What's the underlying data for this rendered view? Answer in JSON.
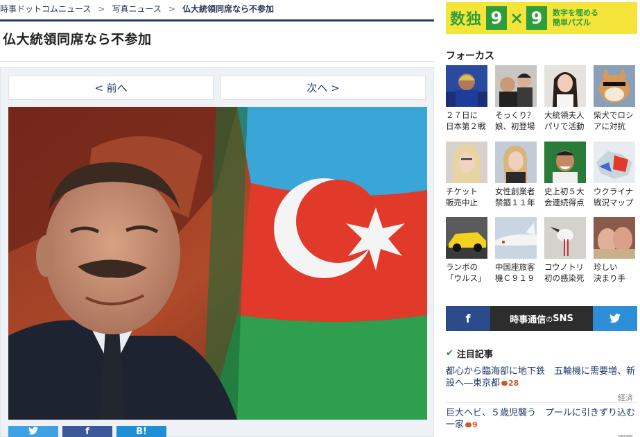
{
  "breadcrumb": {
    "items": [
      "時事ドットコムニュース",
      "写真ニュース",
      "仏大統領同席なら不参加"
    ],
    "separator": ">"
  },
  "article": {
    "title": "仏大統領同席なら不参加"
  },
  "gallery": {
    "prev_label": "< 前へ",
    "next_label": "次へ >",
    "share": {
      "twitter_icon": "twitter-bird-icon",
      "facebook_label": "f",
      "hatena_label": "B!"
    }
  },
  "ad": {
    "logo": "数独",
    "grid": [
      "9",
      "×",
      "9"
    ],
    "copy_line1": "数字を埋める",
    "copy_line2": "簡単パズル"
  },
  "focus": {
    "heading": "フォーカス",
    "items": [
      {
        "line1": "２７日に",
        "line2": "日本第２戦"
      },
      {
        "line1": "そっくり？",
        "line2": "娘、初登場"
      },
      {
        "line1": "大統領夫人",
        "line2": "パリで活動"
      },
      {
        "line1": "柴犬でロシ",
        "line2": "アに対抗"
      },
      {
        "line1": "チケット",
        "line2": "販売中止"
      },
      {
        "line1": "女性創業者",
        "line2": "禁錮１１年"
      },
      {
        "line1": "史上初５大",
        "line2": "会連続得点"
      },
      {
        "line1": "ウクライナ",
        "line2": "戦況マップ"
      },
      {
        "line1": "ランボの",
        "line2": "「ウルス」"
      },
      {
        "line1": "中国座旅客",
        "line2": "機Ｃ９１９"
      },
      {
        "line1": "コウノトリ",
        "line2": "初の感染死"
      },
      {
        "line1": "珍しい",
        "line2": "決まり手"
      }
    ]
  },
  "sns": {
    "facebook_label": "f",
    "label_main": "時事通信",
    "label_small": "の",
    "label_end": "SNS"
  },
  "attention": {
    "heading": "注目記事",
    "articles": [
      {
        "text": "都心から臨海部に地下鉄　五輪機に需要増、新設へ―東京都",
        "comments": "28",
        "category": "経済"
      },
      {
        "text": "巨大ヘビ、５歳児襲う　プールに引きずり込む一家",
        "comments": "9",
        "category": "国際"
      }
    ]
  },
  "colors": {
    "navy": "#1f3a6b",
    "ad_yellow": "#f5e53b",
    "ad_green": "#2f9d3c",
    "facebook": "#3b5998",
    "twitter": "#3fa1e3",
    "comment": "#d2552a"
  }
}
